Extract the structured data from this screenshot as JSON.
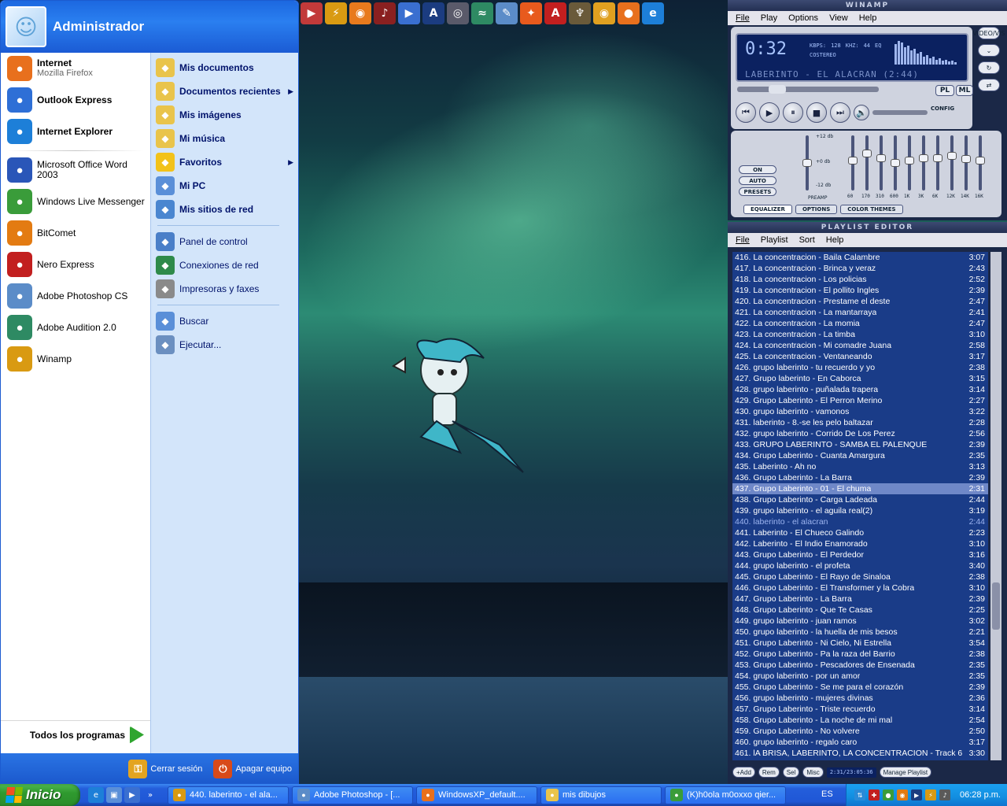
{
  "start_menu": {
    "user": "Administrador",
    "pinned": [
      {
        "name": "Internet",
        "sub": "Mozilla Firefox",
        "icon": "firefox-icon",
        "color": "#e8701d",
        "bold": true
      },
      {
        "name": "Outlook Express",
        "sub": "",
        "icon": "outlook-icon",
        "color": "#2e6fd6",
        "bold": true
      },
      {
        "name": "Internet Explorer",
        "sub": "",
        "icon": "ie-icon",
        "color": "#1d7fd8",
        "bold": true
      }
    ],
    "recent": [
      {
        "name": "Microsoft Office Word 2003",
        "icon": "word-icon",
        "color": "#2a56b8"
      },
      {
        "name": "Windows Live Messenger",
        "icon": "messenger-icon",
        "color": "#3a9c3a"
      },
      {
        "name": "BitComet",
        "icon": "bitcomet-icon",
        "color": "#e37b12"
      },
      {
        "name": "Nero Express",
        "icon": "nero-icon",
        "color": "#c21f1f"
      },
      {
        "name": "Adobe Photoshop CS",
        "icon": "photoshop-icon",
        "color": "#5b8cc8"
      },
      {
        "name": "Adobe Audition 2.0",
        "icon": "audition-icon",
        "color": "#2e8a63"
      },
      {
        "name": "Winamp",
        "icon": "winamp-icon",
        "color": "#d99a12"
      }
    ],
    "all_programs": "Todos los programas",
    "right_group1": [
      {
        "name": "Mis documentos",
        "icon": "folder-docs-icon",
        "color": "#e9c44b",
        "arrow": false
      },
      {
        "name": "Documentos recientes",
        "icon": "recent-docs-icon",
        "color": "#e9c44b",
        "arrow": true
      },
      {
        "name": "Mis imágenes",
        "icon": "folder-pictures-icon",
        "color": "#e9c44b",
        "arrow": false
      },
      {
        "name": "Mi música",
        "icon": "folder-music-icon",
        "color": "#e9c44b",
        "arrow": false
      },
      {
        "name": "Favoritos",
        "icon": "favorites-star-icon",
        "color": "#f2c21a",
        "arrow": true
      },
      {
        "name": "Mi PC",
        "icon": "my-computer-icon",
        "color": "#5a8fd8",
        "arrow": false
      },
      {
        "name": "Mis sitios de red",
        "icon": "network-places-icon",
        "color": "#4a86d0",
        "arrow": false
      }
    ],
    "right_group2": [
      {
        "name": "Panel de control",
        "icon": "control-panel-icon",
        "color": "#4a7fc8"
      },
      {
        "name": "Conexiones de red",
        "icon": "network-connections-icon",
        "color": "#2e8a4a"
      },
      {
        "name": "Impresoras y faxes",
        "icon": "printers-icon",
        "color": "#8a8a8a"
      }
    ],
    "right_group3": [
      {
        "name": "Buscar",
        "icon": "search-icon",
        "color": "#5a8fd8"
      },
      {
        "name": "Ejecutar...",
        "icon": "run-icon",
        "color": "#6b8fc0"
      }
    ],
    "logoff": "Cerrar sesión",
    "shutdown": "Apagar equipo"
  },
  "winamp": {
    "title": "WINAMP",
    "menu": [
      "File",
      "Play",
      "Options",
      "View",
      "Help"
    ],
    "time": "0:32",
    "kbps": "128",
    "khz": "44",
    "kbps_label": "KBPS:",
    "khz_label": "KHZ:",
    "eq_label": "EQ",
    "stereo": "COSTEREO",
    "song_title": "LABERINTO - EL ALACRAN (2:44)",
    "pl_label": "PL",
    "ml_label": "ML",
    "config_label": "CONFIG",
    "videovis": "VIDEO/VIS",
    "eq_bands": [
      "60",
      "170",
      "310",
      "600",
      "1K",
      "3K",
      "6K",
      "12K",
      "14K",
      "16K"
    ],
    "eq_values": [
      0.45,
      0.3,
      0.4,
      0.5,
      0.45,
      0.4,
      0.4,
      0.35,
      0.42,
      0.45
    ],
    "eq_preamp_label": "PREAMP",
    "eq_db_top": "+12 db",
    "eq_db_mid": "+0 db",
    "eq_db_bot": "-12 db",
    "eq_buttons": [
      "ON",
      "AUTO",
      "PRESETS"
    ],
    "eq_tabs": [
      "EQUALIZER",
      "OPTIONS",
      "COLOR THEMES"
    ]
  },
  "playlist": {
    "title": "PLAYLIST EDITOR",
    "menu": [
      "File",
      "Playlist",
      "Sort",
      "Help"
    ],
    "rows": [
      {
        "n": "416.",
        "t": "La concentracion - Baila Calambre",
        "d": "3:07"
      },
      {
        "n": "417.",
        "t": "La concentracion - Brinca y veraz",
        "d": "2:43"
      },
      {
        "n": "418.",
        "t": "La concentracion - Los policias",
        "d": "2:52"
      },
      {
        "n": "419.",
        "t": "La concentracion - El pollito Ingles",
        "d": "2:39"
      },
      {
        "n": "420.",
        "t": "La concentracion - Prestame el deste",
        "d": "2:47"
      },
      {
        "n": "421.",
        "t": "La concentracion - La mantarraya",
        "d": "2:41"
      },
      {
        "n": "422.",
        "t": "La concentracion - La momia",
        "d": "2:47"
      },
      {
        "n": "423.",
        "t": "La concentracion - La timba",
        "d": "3:10"
      },
      {
        "n": "424.",
        "t": "La concentracion - Mi comadre Juana",
        "d": "2:58"
      },
      {
        "n": "425.",
        "t": "La concentracion - Ventaneando",
        "d": "3:17"
      },
      {
        "n": "426.",
        "t": "grupo laberinto - tu recuerdo y yo",
        "d": "2:38"
      },
      {
        "n": "427.",
        "t": "Grupo laberinto - En Caborca",
        "d": "3:15"
      },
      {
        "n": "428.",
        "t": "grupo laberinto - puñalada trapera",
        "d": "3:14"
      },
      {
        "n": "429.",
        "t": "Grupo Laberinto - El Perron Merino",
        "d": "2:27"
      },
      {
        "n": "430.",
        "t": "grupo laberinto - vamonos",
        "d": "3:22"
      },
      {
        "n": "431.",
        "t": "laberinto - 8.-se les pelo baltazar",
        "d": "2:28"
      },
      {
        "n": "432.",
        "t": "grupo laberinto - Corrido De Los Perez",
        "d": "2:56"
      },
      {
        "n": "433.",
        "t": "GRUPO LABERINTO - SAMBA EL PALENQUE",
        "d": "2:39"
      },
      {
        "n": "434.",
        "t": "Grupo Laberinto - Cuanta Amargura",
        "d": "2:35"
      },
      {
        "n": "435.",
        "t": "Laberinto - Ah no",
        "d": "3:13"
      },
      {
        "n": "436.",
        "t": "Grupo Laberinto - La Barra",
        "d": "2:39"
      },
      {
        "n": "437.",
        "t": "Grupo Laberinto - 01 - El chuma",
        "d": "2:31",
        "sel": true
      },
      {
        "n": "438.",
        "t": "Grupo Laberinto - Carga Ladeada",
        "d": "2:44"
      },
      {
        "n": "439.",
        "t": "grupo laberinto - el aguila real(2)",
        "d": "3:19"
      },
      {
        "n": "440.",
        "t": "laberinto - el alacran",
        "d": "2:44",
        "cur": true
      },
      {
        "n": "441.",
        "t": "Laberinto  - El Chueco Galindo",
        "d": "2:23"
      },
      {
        "n": "442.",
        "t": "Laberinto - El Indio Enamorado",
        "d": "3:10"
      },
      {
        "n": "443.",
        "t": "Grupo Laberinto - El Perdedor",
        "d": "3:16"
      },
      {
        "n": "444.",
        "t": "grupo laberinto - el profeta",
        "d": "3:40"
      },
      {
        "n": "445.",
        "t": "Grupo Laberinto - El Rayo de Sinaloa",
        "d": "2:38"
      },
      {
        "n": "446.",
        "t": "Grupo Laberinto - El Transformer y la Cobra",
        "d": "3:10"
      },
      {
        "n": "447.",
        "t": "Grupo Laberinto - La Barra",
        "d": "2:39"
      },
      {
        "n": "448.",
        "t": "Grupo Laberinto - Que Te Casas",
        "d": "2:25"
      },
      {
        "n": "449.",
        "t": "grupo laberinto - juan ramos",
        "d": "3:02"
      },
      {
        "n": "450.",
        "t": "grupo laberinto - la huella de mis besos",
        "d": "2:21"
      },
      {
        "n": "451.",
        "t": "Grupo Laberinto - Ni Cielo, Ni Estrella",
        "d": "3:54"
      },
      {
        "n": "452.",
        "t": "Grupo Laberinto - Pa la raza del Barrio",
        "d": "2:38"
      },
      {
        "n": "453.",
        "t": "Grupo Laberinto - Pescadores de Ensenada",
        "d": "2:35"
      },
      {
        "n": "454.",
        "t": "grupo laberinto - por un amor",
        "d": "2:35"
      },
      {
        "n": "455.",
        "t": "Grupo Laberinto - Se me para el corazón",
        "d": "2:39"
      },
      {
        "n": "456.",
        "t": "grupo laberinto - mujeres divinas",
        "d": "2:36"
      },
      {
        "n": "457.",
        "t": "Grupo Laberinto - Triste recuerdo",
        "d": "3:14"
      },
      {
        "n": "458.",
        "t": "Grupo Laberinto - La noche de mi mal",
        "d": "2:54"
      },
      {
        "n": "459.",
        "t": "Grupo Laberinto - No volvere",
        "d": "2:50"
      },
      {
        "n": "460.",
        "t": "grupo laberinto - regalo caro",
        "d": "3:17"
      },
      {
        "n": "461.",
        "t": "lA BRISA, LABERINTO, LA CONCENTRACION - Track 6",
        "d": "3:30"
      }
    ],
    "buttons": [
      "+Add",
      "Rem",
      "Sel",
      "Misc"
    ],
    "time_display": "2:31/23:05:36",
    "manage": "Manage Playlist"
  },
  "taskbar": {
    "start": "Inicio",
    "tasks": [
      {
        "label": "440. laberinto - el ala...",
        "icon": "winamp-icon",
        "color": "#d99a12"
      },
      {
        "label": "Adobe Photoshop - [...",
        "icon": "photoshop-icon",
        "color": "#5b8cc8"
      },
      {
        "label": "WindowsXP_default....",
        "icon": "firefox-icon",
        "color": "#e8701d"
      },
      {
        "label": "mis dibujos",
        "icon": "folder-icon",
        "color": "#e9c44b"
      },
      {
        "label": "(K)h0ola m0oxxo qier...",
        "icon": "messenger-icon",
        "color": "#3a9c3a"
      }
    ],
    "lang": "ES",
    "clock": "06:28 p.m."
  }
}
